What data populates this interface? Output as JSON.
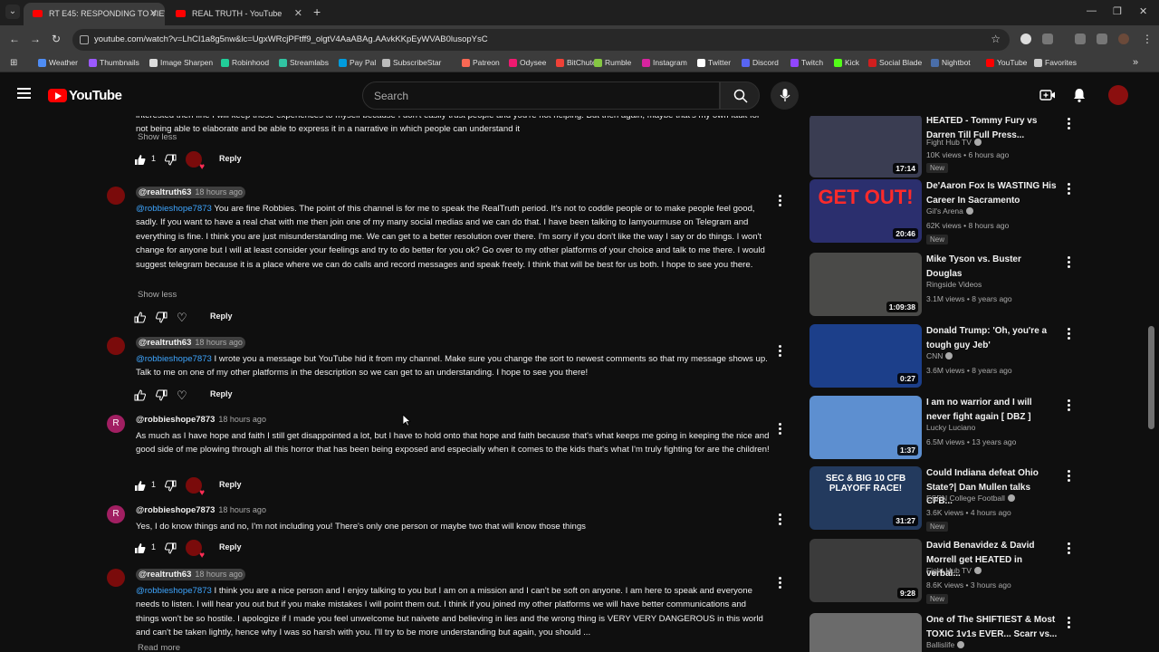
{
  "browser": {
    "tabs": [
      {
        "label": "RT E45: RESPONDING TO VIEW",
        "active": true
      },
      {
        "label": "REAL TRUTH - YouTube",
        "active": false
      }
    ],
    "url": "youtube.com/watch?v=LhCI1a8g5nw&lc=UgxWRcjPFtff9_olgtV4AaABAg.AAvkKKpEyWVAB0lusopYsC",
    "bookmarks": [
      {
        "label": "Weather",
        "color": "#4f8df5"
      },
      {
        "label": "Thumbnails",
        "color": "#9b59ff"
      },
      {
        "label": "Image Sharpen",
        "color": "#dddddd"
      },
      {
        "label": "Robinhood",
        "color": "#21ce99"
      },
      {
        "label": "Streamlabs",
        "color": "#31c3a2"
      },
      {
        "label": "Pay Pal",
        "color": "#009cde"
      },
      {
        "label": "SubscribeStar",
        "color": "#bbbbbb"
      },
      {
        "label": "Patreon",
        "color": "#f96854"
      },
      {
        "label": "Odysee",
        "color": "#ef1970"
      },
      {
        "label": "BitChute",
        "color": "#ef4137"
      },
      {
        "label": "Rumble",
        "color": "#85c742"
      },
      {
        "label": "Instagram",
        "color": "#d6249f"
      },
      {
        "label": "Twitter",
        "color": "#ffffff"
      },
      {
        "label": "Discord",
        "color": "#5865f2"
      },
      {
        "label": "Twitch",
        "color": "#9146ff"
      },
      {
        "label": "Kick",
        "color": "#53fc18"
      },
      {
        "label": "Social Blade",
        "color": "#d01e1e"
      },
      {
        "label": "Nightbot",
        "color": "#4a6ea9"
      },
      {
        "label": "YouTube",
        "color": "#ff0000"
      },
      {
        "label": "Favorites",
        "color": "#cccccc"
      }
    ]
  },
  "header": {
    "logo": "YouTube",
    "search_placeholder": "Search"
  },
  "comments": [
    {
      "type": "tail",
      "body": "interested then fine I will keep those experiences to myself because I don't easily trust people and you're not helping.  But then again, maybe that's my own fault for not being able to elaborate and be able to express it in a narrative in which people can understand it",
      "more": "Show less",
      "likes": "1",
      "hearted": true,
      "reply": "Reply"
    },
    {
      "author": "@realtruth63",
      "time": "18 hours ago",
      "mention": "@robbieshope7873",
      "body": " You are fine Robbies. The point of this channel is for me to speak the RealTruth period. It's not to coddle people or to make people feel good, sadly. If you want to have a real chat with me then join one of my many social medias and we can do that. I have been talking to Iamyourmuse on Telegram and everything is fine. I think you are just misunderstanding me. We can get to a better resolution over there. I'm sorry if you don't like the way I say or do things. I won't change for anyone but I will at least consider your feelings and try to do better for you ok? Go over to my other platforms of your choice and talk to me there. I would suggest telegram because it is a place where we can do calls and record messages and speak freely. I think that will be best for us both. I hope to see you there.",
      "more": "Show less",
      "likes": "",
      "hearted": false,
      "reply": "Reply"
    },
    {
      "author": "@realtruth63",
      "time": "18 hours ago",
      "mention": "@robbieshope7873",
      "body": " I wrote you a message but YouTube hid it from my channel. Make sure you change the sort to newest comments so that my message shows up. Talk to me on one of my other platforms in the description so we can get to an understanding. I hope to see you there!",
      "likes": "",
      "hearted": false,
      "reply": "Reply"
    },
    {
      "author": "@robbieshope7873",
      "initial": "R",
      "time": "18 hours ago",
      "body": "As much as I have hope and faith I still get disappointed a lot, but I have to hold onto that hope and faith because that's what keeps me going in keeping the nice and good side of me plowing through all this horror that has been being exposed and especially when it comes to the kids that's what I'm truly fighting for are the children!",
      "likes": "1",
      "hearted": true,
      "reply": "Reply"
    },
    {
      "author": "@robbieshope7873",
      "initial": "R",
      "time": "18 hours ago",
      "body": "Yes, I do know things and no, I'm not including you! There's only one person or maybe two that will know those things",
      "likes": "1",
      "hearted": true,
      "reply": "Reply"
    },
    {
      "author": "@realtruth63",
      "time": "18 hours ago",
      "mention": "@robbieshope7873",
      "body": " I think you are a nice person and I enjoy talking to you but I am on a mission and I can't be soft on anyone. I am here to speak and everyone needs to listen. I will hear you out but if you make mistakes I will point them out. I think if you joined my other platforms we will have better communications and things won't be so hostile. I apologize if I made you feel unwelcome but naivete and believing in lies and the wrong thing is VERY VERY DANGEROUS in this world and can't be taken lightly, hence why I was so harsh with you. I'll try to be more understanding but again, you should ...",
      "more": "Read more"
    }
  ],
  "related": [
    {
      "title": "HEATED - Tommy Fury vs Darren Till Full Press...",
      "channel": "Fight Hub TV",
      "verified": true,
      "views": "10K views",
      "age": "6 hours ago",
      "duration": "17:14",
      "new": "New",
      "thumb_color": "#3a3d52"
    },
    {
      "title": "De'Aaron Fox Is WASTING His Career In Sacramento",
      "channel": "Gil's Arena",
      "verified": true,
      "views": "62K views",
      "age": "8 hours ago",
      "duration": "20:46",
      "new": "New",
      "thumb_color": "#2b2f6e",
      "thumb_text": "GET OUT!"
    },
    {
      "title": "Mike Tyson vs. Buster Douglas",
      "channel": "Ringside Videos",
      "verified": false,
      "views": "3.1M views",
      "age": "8 years ago",
      "duration": "1:09:38",
      "thumb_color": "#4a4a48"
    },
    {
      "title": "Donald Trump: 'Oh, you're a tough guy Jeb'",
      "channel": "CNN",
      "verified": true,
      "views": "3.6M views",
      "age": "8 years ago",
      "duration": "0:27",
      "thumb_color": "#1c3f8a"
    },
    {
      "title": "I am no warrior and I will never fight again [ DBZ ]",
      "channel": "Lucky Luciano",
      "verified": false,
      "views": "6.5M views",
      "age": "13 years ago",
      "duration": "1:37",
      "thumb_color": "#5d8fd0"
    },
    {
      "title": "Could Indiana defeat Ohio State?| Dan Mullen talks CFB...",
      "channel": "ESPN College Football",
      "verified": true,
      "views": "3.6K views",
      "age": "4 hours ago",
      "duration": "31:27",
      "new": "New",
      "thumb_color": "#233a5e",
      "thumb_text": "SEC & BIG 10 CFB PLAYOFF RACE!"
    },
    {
      "title": "David Benavidez & David Morrell get HEATED in verbal...",
      "channel": "Fight Hub TV",
      "verified": true,
      "views": "8.6K views",
      "age": "3 hours ago",
      "duration": "9:28",
      "new": "New",
      "thumb_color": "#3b3b3b"
    },
    {
      "title": "One of The SHIFTIEST & Most TOXIC 1v1s EVER... Scarr vs...",
      "channel": "Ballislife",
      "verified": true,
      "views": "",
      "age": "",
      "duration": "",
      "thumb_color": "#6b6b6b"
    }
  ]
}
